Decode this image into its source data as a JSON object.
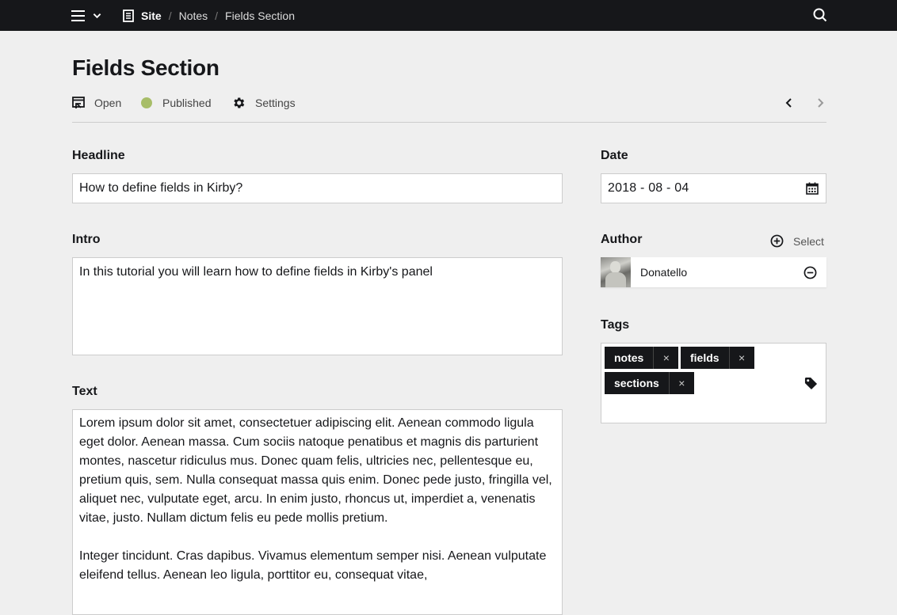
{
  "topbar": {
    "breadcrumbs": [
      {
        "label": "Site"
      },
      {
        "label": "Notes"
      },
      {
        "label": "Fields Section"
      }
    ],
    "separator": "/"
  },
  "header": {
    "title": "Fields Section",
    "open_label": "Open",
    "status_label": "Published",
    "status_color": "#a7bd68",
    "settings_label": "Settings"
  },
  "fields": {
    "headline": {
      "label": "Headline",
      "value": "How to define fields in Kirby?"
    },
    "intro": {
      "label": "Intro",
      "value": "In this tutorial you will learn how to define fields in Kirby's panel"
    },
    "text": {
      "label": "Text",
      "paragraphs": [
        "Lorem ipsum dolor sit amet, consectetuer adipiscing elit. Aenean commodo ligula eget dolor. Aenean massa. Cum sociis natoque penatibus et magnis dis parturient montes, nascetur ridiculus mus. Donec quam felis, ultricies nec, pellentesque eu, pretium quis, sem. Nulla consequat massa quis enim. Donec pede justo, fringilla vel, aliquet nec, vulputate eget, arcu. In enim justo, rhoncus ut, imperdiet a, venenatis vitae, justo. Nullam dictum felis eu pede mollis pretium.",
        "Integer tincidunt. Cras dapibus. Vivamus elementum semper nisi. Aenean vulputate eleifend tellus. Aenean leo ligula, porttitor eu, consequat vitae,"
      ]
    },
    "date": {
      "label": "Date",
      "value": "2018 - 08 - 04"
    },
    "author": {
      "label": "Author",
      "select_label": "Select",
      "name": "Donatello"
    },
    "tags": {
      "label": "Tags",
      "items": [
        "notes",
        "fields",
        "sections"
      ],
      "remove_glyph": "×"
    }
  },
  "icons": {
    "menu": "hamburger-icon",
    "page": "page-icon",
    "search": "search-icon",
    "open": "open-icon",
    "settings": "gear-icon",
    "calendar": "calendar-icon",
    "add": "add-circle-icon",
    "remove": "remove-circle-icon",
    "tag": "tag-icon"
  }
}
